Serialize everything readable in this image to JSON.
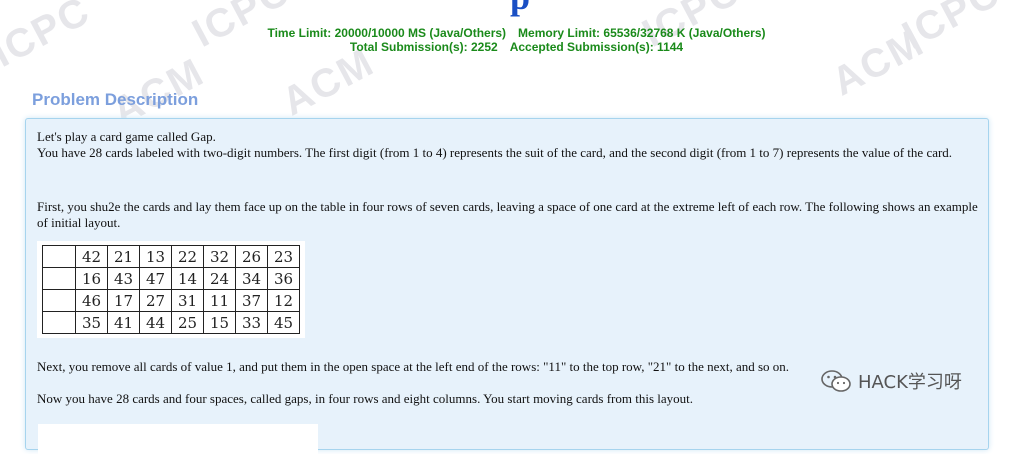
{
  "watermark_text": "ACM ICPC",
  "header": {
    "time_limit": "Time Limit: 20000/10000 MS (Java/Others)",
    "memory_limit": "Memory Limit: 65536/32768 K (Java/Others)",
    "total_submissions": "Total Submission(s): 2252",
    "accepted_submissions": "Accepted Submission(s): 1144"
  },
  "section": {
    "title": "Problem Description"
  },
  "description": {
    "intro_line": "Let's play a card game called Gap.",
    "p1_rest": "You have 28 cards labeled with two-digit numbers. The first digit (from 1 to 4) represents the suit of the card, and the second digit (from 1 to 7) represents the value of the card.",
    "p2": "First, you shu2e the cards and lay them face up on the table in four rows of seven cards, leaving a space of one card at the extreme left of each row. The following shows an example of initial layout.",
    "p3": "Next, you remove all cards of value 1, and put them in the open space at the left end of the rows: \"11\" to the top row, \"21\" to the next, and so on.",
    "p4": "Now you have 28 cards and four spaces, called gaps, in four rows and eight columns. You start moving cards from this layout."
  },
  "layout_table": {
    "rows": [
      [
        "",
        "42",
        "21",
        "13",
        "22",
        "32",
        "26",
        "23"
      ],
      [
        "",
        "16",
        "43",
        "47",
        "14",
        "24",
        "34",
        "36"
      ],
      [
        "",
        "46",
        "17",
        "27",
        "31",
        "11",
        "37",
        "12"
      ],
      [
        "",
        "35",
        "41",
        "44",
        "25",
        "15",
        "33",
        "45"
      ]
    ]
  },
  "brand": {
    "label": "HACK学习呀",
    "icon": "wechat-icon"
  },
  "colors": {
    "limits_text": "#1a8a1a",
    "section_title": "#7c9fdd",
    "panel_bg": "#e7f2fb",
    "panel_border": "#a6d4ee",
    "title_blue": "#1a4fc4"
  }
}
